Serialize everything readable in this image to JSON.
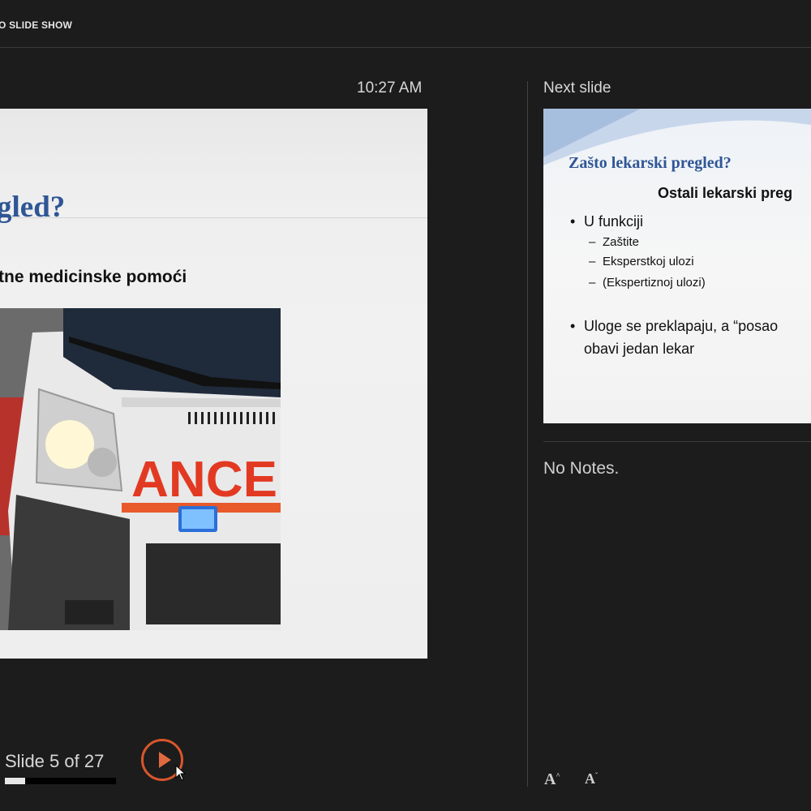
{
  "toolbar": {
    "end_slide_show": "O SLIDE SHOW"
  },
  "presenter": {
    "clock": "10:27 AM",
    "next_slide_label": "Next slide",
    "notes": "No Notes.",
    "slide_counter": "Slide 5 of 27",
    "progress_fraction": 0.185
  },
  "current_slide": {
    "title": "gled?",
    "subtitle": "tne medicinske pomoći",
    "photo_text": "ANCE"
  },
  "next_slide": {
    "title": "Zašto lekarski pregled?",
    "subtitle": "Ostali lekarski preg",
    "bullet1": "U funkciji",
    "sub_bullets": [
      "Zaštite",
      "Eksperstkoj ulozi",
      "(Ekspertiznoj  ulozi)"
    ],
    "bullet2_line1": "Uloge se preklapaju, a “posao",
    "bullet2_line2": "obavi jedan lekar"
  },
  "font_controls": {
    "increase": "A",
    "decrease": "A"
  },
  "colors": {
    "accent": "#d9562b",
    "title_blue": "#2f5696",
    "background": "#1c1c1c"
  }
}
